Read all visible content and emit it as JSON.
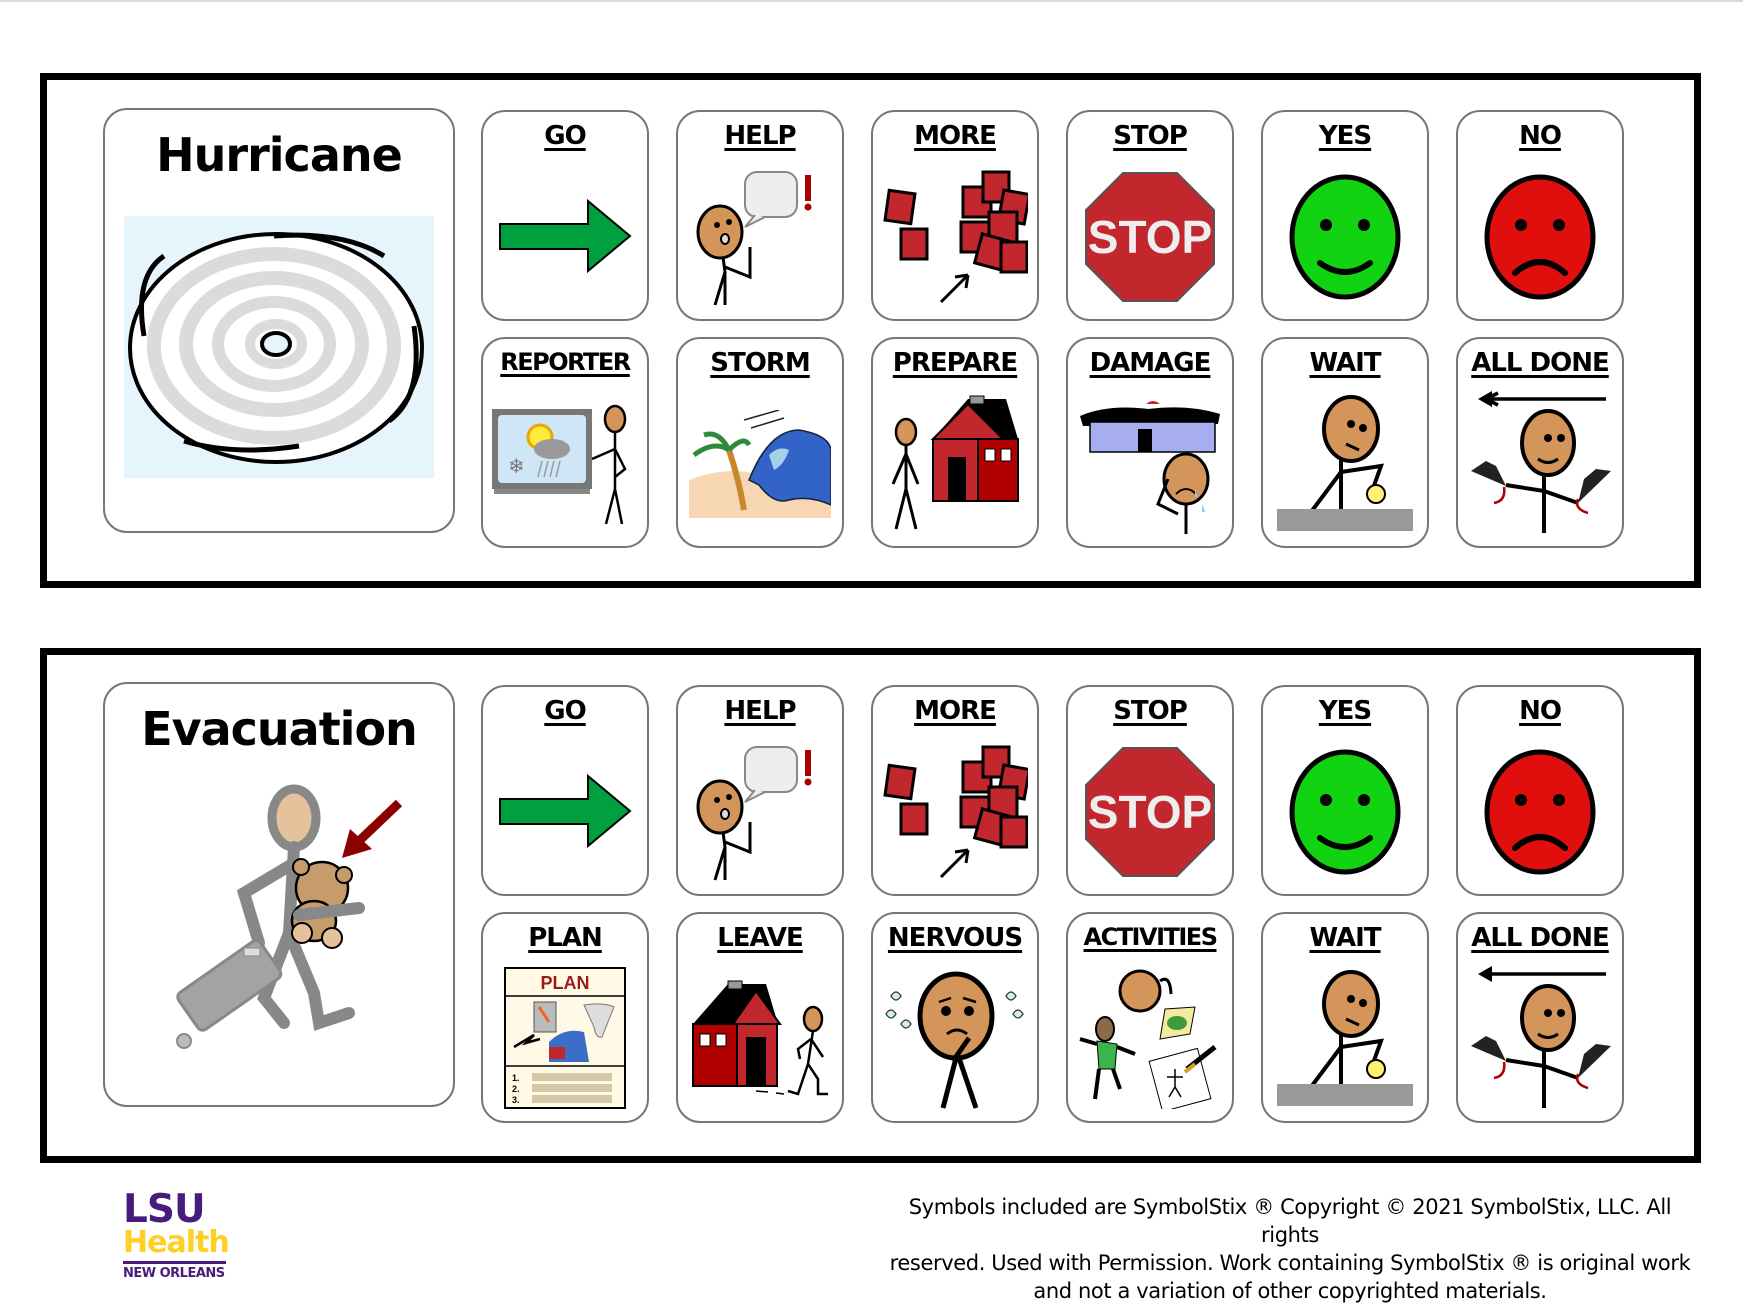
{
  "boards": [
    {
      "title": "Hurricane",
      "title_icon": "hurricane-icon",
      "row1": [
        {
          "label": "GO",
          "icon": "green-right-arrow-icon"
        },
        {
          "label": "HELP",
          "icon": "person-calling-help-icon"
        },
        {
          "label": "MORE",
          "icon": "red-blocks-more-icon"
        },
        {
          "label": "STOP",
          "icon": "stop-sign-icon"
        },
        {
          "label": "YES",
          "icon": "green-smiley-icon"
        },
        {
          "label": "NO",
          "icon": "red-frowny-icon"
        }
      ],
      "row2": [
        {
          "label": "REPORTER",
          "icon": "weather-reporter-icon"
        },
        {
          "label": "STORM",
          "icon": "storm-wave-palm-icon"
        },
        {
          "label": "PREPARE",
          "icon": "person-house-icon"
        },
        {
          "label": "DAMAGE",
          "icon": "damaged-house-crying-icon"
        },
        {
          "label": "WAIT",
          "icon": "person-waiting-watch-icon"
        },
        {
          "label": "ALL DONE",
          "icon": "all-done-hands-icon"
        }
      ]
    },
    {
      "title": "Evacuation",
      "title_icon": "person-evacuating-luggage-icon",
      "row1": [
        {
          "label": "GO",
          "icon": "green-right-arrow-icon"
        },
        {
          "label": "HELP",
          "icon": "person-calling-help-icon"
        },
        {
          "label": "MORE",
          "icon": "red-blocks-more-icon"
        },
        {
          "label": "STOP",
          "icon": "stop-sign-icon"
        },
        {
          "label": "YES",
          "icon": "green-smiley-icon"
        },
        {
          "label": "NO",
          "icon": "red-frowny-icon"
        }
      ],
      "row2": [
        {
          "label": "PLAN",
          "icon": "emergency-plan-icon"
        },
        {
          "label": "LEAVE",
          "icon": "person-leaving-house-icon"
        },
        {
          "label": "NERVOUS",
          "icon": "nervous-face-icon"
        },
        {
          "label": "ACTIVITIES",
          "icon": "activities-icon"
        },
        {
          "label": "WAIT",
          "icon": "person-waiting-watch-icon"
        },
        {
          "label": "ALL DONE",
          "icon": "all-done-hands-icon"
        }
      ]
    }
  ],
  "icon_text": {
    "stop_sign": "STOP",
    "plan_header": "PLAN",
    "plan_items": [
      "1.",
      "2.",
      "3."
    ]
  },
  "footer": {
    "logo": {
      "line1": "LSU",
      "line2": "Health",
      "line3": "NEW ORLEANS"
    },
    "copyright_lines": [
      "Symbols included are SymbolStix ® Copyright © 2021 SymbolStix, LLC. All rights",
      "reserved. Used with Permission. Work containing SymbolStix ® is original work",
      "and not a variation of other copyrighted materials."
    ]
  },
  "colors": {
    "go_green": "#00A03E",
    "stop_red": "#C1272D",
    "yes_green": "#12D312",
    "no_red": "#E10E0E",
    "skin": "#D4955A",
    "lsu_purple": "#461D7C",
    "lsu_gold": "#FDD023"
  }
}
